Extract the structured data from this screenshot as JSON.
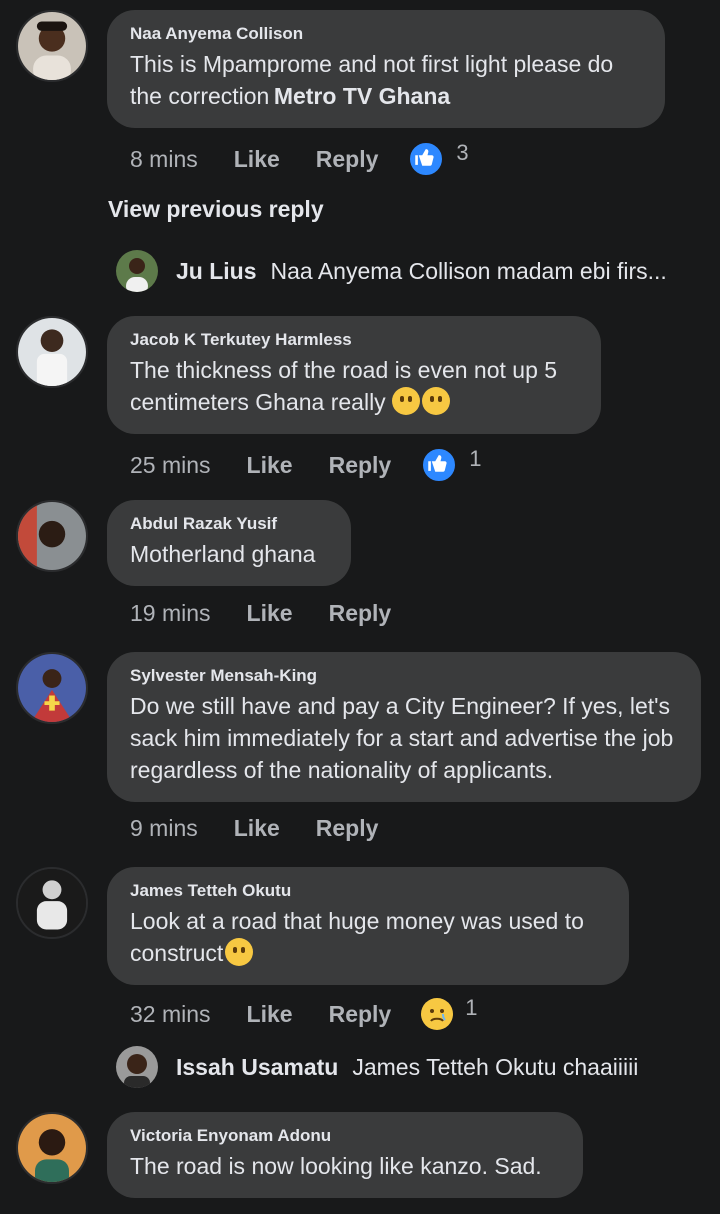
{
  "comments": [
    {
      "author": "Naa Anyema Collison",
      "text": "This is Mpamprome and not first light please do the correction",
      "tag": "Metro TV Ghana",
      "time": "8 mins",
      "like": "Like",
      "reply": "Reply",
      "reaction_count": "3"
    },
    {
      "author": "Jacob K Terkutey Harmless",
      "text": "The thickness of the road is even not up 5 centimeters Ghana really",
      "time": "25 mins",
      "like": "Like",
      "reply": "Reply",
      "reaction_count": "1"
    },
    {
      "author": "Abdul Razak Yusif",
      "text": "Motherland ghana",
      "time": "19 mins",
      "like": "Like",
      "reply": "Reply"
    },
    {
      "author": "Sylvester Mensah-King",
      "text": "Do we still have  and pay a City  Engineer? If yes, let's sack him immediately for a start and advertise the job regardless of the nationality of applicants.",
      "time": "9 mins",
      "like": "Like",
      "reply": "Reply"
    },
    {
      "author": "James Tetteh Okutu",
      "text": "Look at a road that huge money was used to construct",
      "time": "32 mins",
      "like": "Like",
      "reply": "Reply",
      "reaction_count": "1"
    },
    {
      "author": "Victoria Enyonam Adonu",
      "text": "The road is now looking like kanzo. Sad."
    }
  ],
  "view_previous_reply": "View previous reply",
  "replies": [
    {
      "name": "Ju Lius",
      "snippet": "Naa Anyema Collison madam ebi firs..."
    },
    {
      "name": "Issah Usamatu",
      "snippet": "James Tetteh Okutu chaaiiiii"
    }
  ],
  "colors": {
    "background": "#18191a",
    "bubble": "#3a3b3c",
    "like_blue": "#2d88ff",
    "sad_yellow": "#f7c842"
  }
}
